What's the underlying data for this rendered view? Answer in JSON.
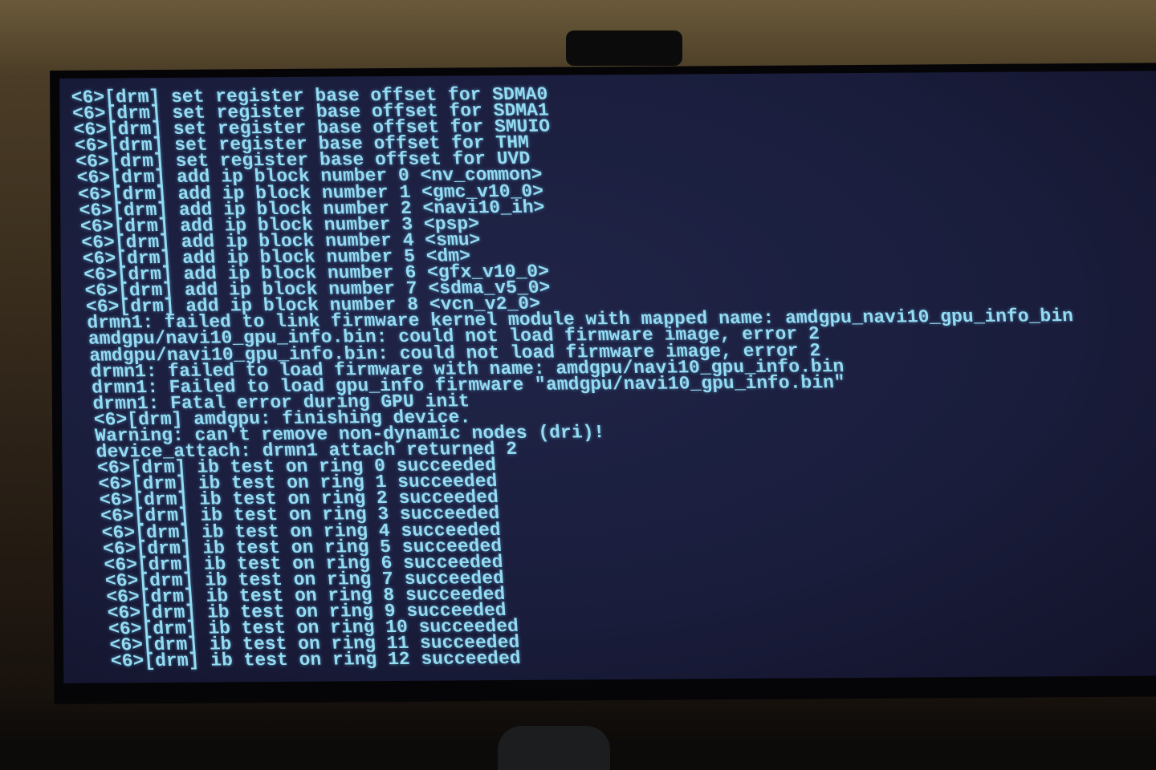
{
  "console": {
    "lines": [
      "<6>[drm] set register base offset for SDMA0",
      "<6>[drm] set register base offset for SDMA1",
      "<6>[drm] set register base offset for SMUIO",
      "<6>[drm] set register base offset for THM",
      "<6>[drm] set register base offset for UVD",
      "<6>[drm] add ip block number 0 <nv_common>",
      "<6>[drm] add ip block number 1 <gmc_v10_0>",
      "<6>[drm] add ip block number 2 <navi10_ih>",
      "<6>[drm] add ip block number 3 <psp>",
      "<6>[drm] add ip block number 4 <smu>",
      "<6>[drm] add ip block number 5 <dm>",
      "<6>[drm] add ip block number 6 <gfx_v10_0>",
      "<6>[drm] add ip block number 7 <sdma_v5_0>",
      "<6>[drm] add ip block number 8 <vcn_v2_0>",
      "drmn1: failed to link firmware kernel module with mapped name: amdgpu_navi10_gpu_info_bin",
      "amdgpu/navi10_gpu_info.bin: could not load firmware image, error 2",
      "amdgpu/navi10_gpu_info.bin: could not load firmware image, error 2",
      "drmn1: failed to load firmware with name: amdgpu/navi10_gpu_info.bin",
      "drmn1: Failed to load gpu_info firmware \"amdgpu/navi10_gpu_info.bin\"",
      "drmn1: Fatal error during GPU init",
      "<6>[drm] amdgpu: finishing device.",
      "Warning: can't remove non-dynamic nodes (dri)!",
      "device_attach: drmn1 attach returned 2",
      "<6>[drm] ib test on ring 0 succeeded",
      "<6>[drm] ib test on ring 1 succeeded",
      "<6>[drm] ib test on ring 2 succeeded",
      "<6>[drm] ib test on ring 3 succeeded",
      "<6>[drm] ib test on ring 4 succeeded",
      "<6>[drm] ib test on ring 5 succeeded",
      "<6>[drm] ib test on ring 6 succeeded",
      "<6>[drm] ib test on ring 7 succeeded",
      "<6>[drm] ib test on ring 8 succeeded",
      "<6>[drm] ib test on ring 9 succeeded",
      "<6>[drm] ib test on ring 10 succeeded",
      "<6>[drm] ib test on ring 11 succeeded",
      "<6>[drm] ib test on ring 12 succeeded"
    ]
  },
  "colors": {
    "text": "#94dcf2",
    "screen": "#1a1d3c"
  }
}
